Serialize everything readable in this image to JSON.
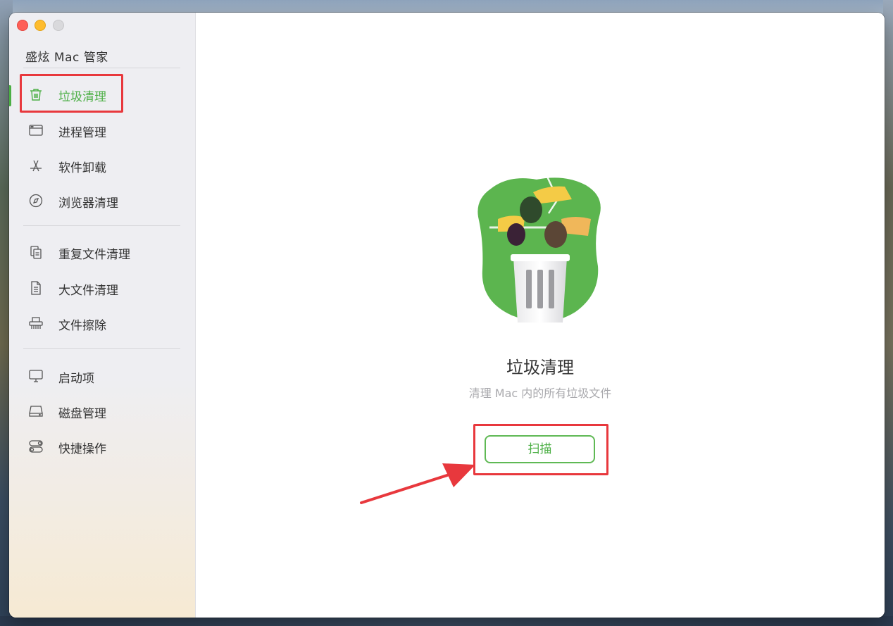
{
  "app": {
    "title": "盛炫 Mac 管家"
  },
  "sidebar": {
    "groups": [
      {
        "items": [
          {
            "label": "垃圾清理",
            "icon": "trash-icon",
            "active": true
          },
          {
            "label": "进程管理",
            "icon": "window-icon"
          },
          {
            "label": "软件卸载",
            "icon": "app-store-icon"
          },
          {
            "label": "浏览器清理",
            "icon": "compass-icon"
          }
        ]
      },
      {
        "items": [
          {
            "label": "重复文件清理",
            "icon": "duplicate-files-icon"
          },
          {
            "label": "大文件清理",
            "icon": "document-icon"
          },
          {
            "label": "文件擦除",
            "icon": "shredder-icon"
          }
        ]
      },
      {
        "items": [
          {
            "label": "启动项",
            "icon": "monitor-icon"
          },
          {
            "label": "磁盘管理",
            "icon": "disk-icon"
          },
          {
            "label": "快捷操作",
            "icon": "toggles-icon"
          }
        ]
      }
    ]
  },
  "main": {
    "title": "垃圾清理",
    "subtitle": "清理 Mac 内的所有垃圾文件",
    "scan_button": "扫描",
    "illustration": "trash-bin-hands-illustration"
  },
  "colors": {
    "accent": "#4caf45",
    "highlight": "#e8383d",
    "sidebar_bg": "#eeeef2"
  }
}
